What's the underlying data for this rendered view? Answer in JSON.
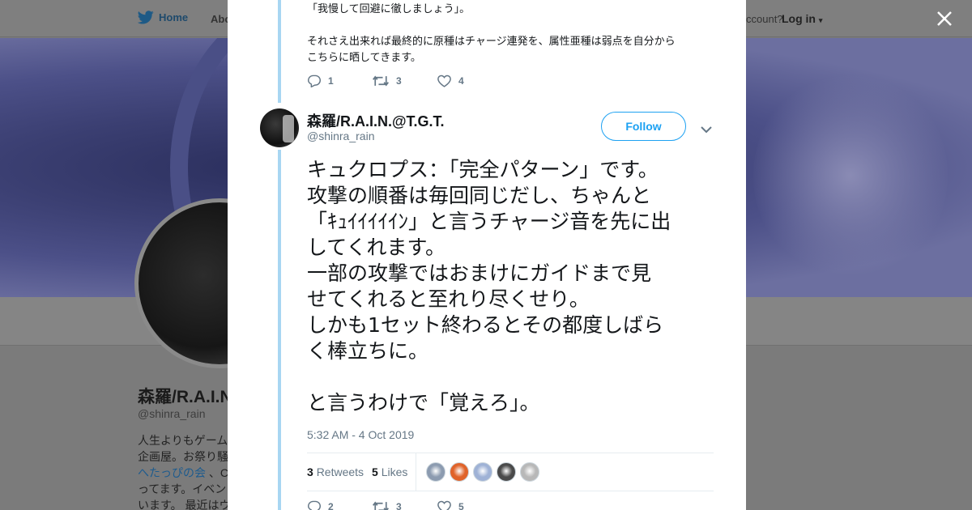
{
  "nav": {
    "home_label": "Home",
    "about_label": "Abo",
    "account_text": "ccount?",
    "login_label": "Log in"
  },
  "profile": {
    "name": "森羅/R.A.I.N",
    "handle": "@shinra_rain",
    "bio_lines": [
      "人生よりもゲーム",
      "企画屋。お祭り騒",
      "へたっぴの会 、C",
      "ってます。イベン",
      "います。 最近はウ"
    ],
    "bio_link": "へたっぴの会"
  },
  "prev_tweet": {
    "text": "「我慢して回避に徹しましょう」。\n\nそれさえ出来れば最終的に原種はチャージ連発を、属性亜種は弱点を自分から\nこちらに晒してきます。",
    "replies": "1",
    "retweets": "3",
    "likes": "4"
  },
  "tweet": {
    "display_name": "森羅/R.A.I.N.@T.G.T.",
    "handle": "@shinra_rain",
    "follow_label": "Follow",
    "text": "キュクロプス：「完全パターン」です。\n攻撃の順番は毎回同じだし、ちゃんと\n「ｷｭｲｲｲｲｲﾝ」と言うチャージ音を先に出\nしてくれます。\n一部の攻撃ではおまけにガイドまで見\nせてくれると至れり尽くせり。\nしかも1セット終わるとその都度しばら\nく棒立ちに。\n\nと言うわけで「覚えろ」。",
    "timestamp": "5:32 AM - 4 Oct 2019",
    "retweet_count": "3",
    "retweets_label": "Retweets",
    "like_count": "5",
    "likes_label": "Likes",
    "replies": "2",
    "retweets": "3",
    "likes": "5"
  },
  "likers": [
    {
      "name": "liker-1",
      "color": "#8c9bb0"
    },
    {
      "name": "liker-2",
      "color": "#e0632a"
    },
    {
      "name": "liker-3",
      "color": "#9fb2d6"
    },
    {
      "name": "liker-4",
      "color": "#4a4a4a"
    },
    {
      "name": "liker-5",
      "color": "#b8b8b8"
    }
  ],
  "colors": {
    "accent": "#1da1f2",
    "thread_line": "#a8d6f2",
    "overlay": "#7b7b7b"
  },
  "icons": [
    "twitter-bird-icon",
    "reply-icon",
    "retweet-icon",
    "heart-icon",
    "chevron-down-icon",
    "close-icon"
  ]
}
